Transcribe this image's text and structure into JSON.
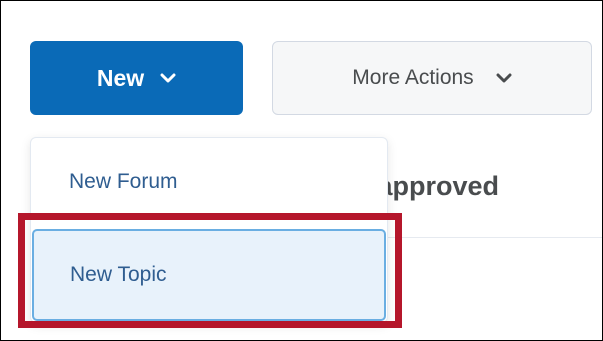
{
  "toolbar": {
    "new_label": "New",
    "more_actions_label": "More Actions"
  },
  "background": {
    "partial_heading": "napproved"
  },
  "dropdown": {
    "items": [
      {
        "label": "New Forum"
      },
      {
        "label": "New Topic"
      }
    ]
  },
  "icons": {
    "new_chevron": "chevron-down-icon",
    "more_chevron": "chevron-down-icon"
  },
  "colors": {
    "primary_button": "#0a6ab7",
    "menu_text": "#2f5d90",
    "hover_item_bg": "#e8f2fb",
    "hover_item_border": "#6aaee2",
    "highlight_box": "#b5162b"
  }
}
